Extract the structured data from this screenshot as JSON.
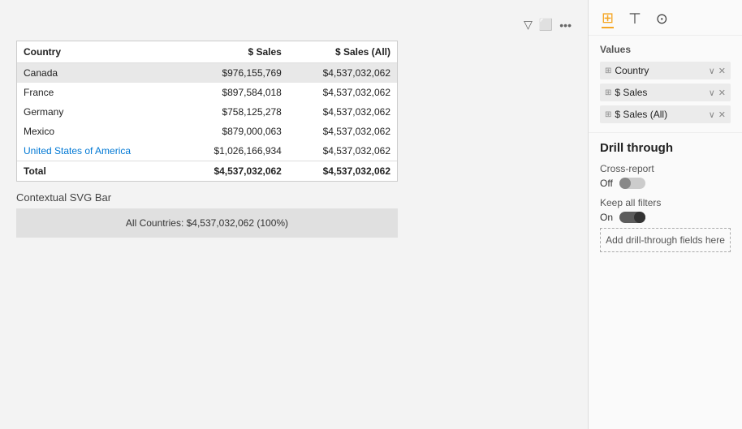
{
  "panel": {
    "values_label": "Values",
    "icons": [
      {
        "name": "table-icon",
        "symbol": "⊞"
      },
      {
        "name": "filter-icon",
        "symbol": "🔽"
      },
      {
        "name": "settings-icon",
        "symbol": "⚙"
      }
    ],
    "fields": [
      {
        "label": "Country",
        "removable": true
      },
      {
        "label": "$ Sales",
        "removable": true
      },
      {
        "label": "$ Sales (All)",
        "removable": true
      }
    ],
    "drill_through": {
      "title": "Drill through",
      "cross_report_label": "Cross-report",
      "cross_report_state": "Off",
      "keep_filters_label": "Keep all filters",
      "keep_filters_state": "On",
      "add_btn": "Add drill-through fields here"
    }
  },
  "table": {
    "toolbar": {
      "filter_icon": "▽",
      "expand_icon": "⬜",
      "more_icon": "···"
    },
    "columns": [
      "Country",
      "$ Sales",
      "$ Sales (All)"
    ],
    "rows": [
      {
        "country": "Canada",
        "sales": "$976,155,769",
        "sales_all": "$4,537,032,062",
        "selected": true
      },
      {
        "country": "France",
        "sales": "$897,584,018",
        "sales_all": "$4,537,032,062",
        "selected": false
      },
      {
        "country": "Germany",
        "sales": "$758,125,278",
        "sales_all": "$4,537,032,062",
        "selected": false
      },
      {
        "country": "Mexico",
        "sales": "$879,000,063",
        "sales_all": "$4,537,032,062",
        "selected": false
      },
      {
        "country": "United States of America",
        "sales": "$1,026,166,934",
        "sales_all": "$4,537,032,062",
        "selected": false
      }
    ],
    "footer": {
      "label": "Total",
      "sales": "$4,537,032,062",
      "sales_all": "$4,537,032,062"
    }
  },
  "contextual": {
    "label": "Contextual SVG Bar",
    "bar_text": "All Countries: $4,537,032,062 (100%)"
  }
}
